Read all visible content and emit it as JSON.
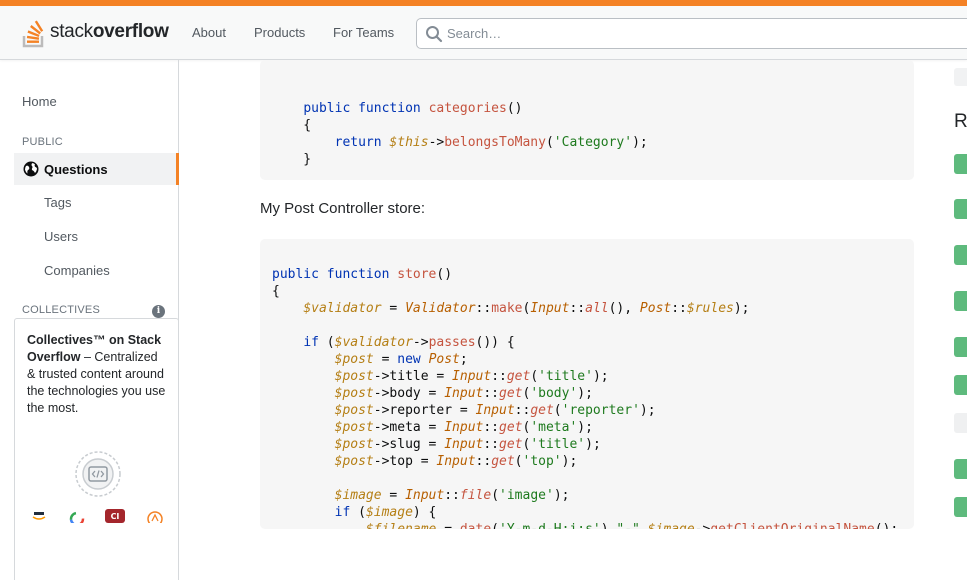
{
  "header": {
    "logo_text_regular": "stack",
    "logo_text_bold": "overflow",
    "nav": [
      "About",
      "Products",
      "For Teams"
    ],
    "search_placeholder": "Search…"
  },
  "sidebar": {
    "home": "Home",
    "public_section": "PUBLIC",
    "active_item": "Questions",
    "items": [
      "Tags",
      "Users",
      "Companies"
    ],
    "collectives_section": "COLLECTIVES",
    "collectives_title": "Collectives™ on Stack Overflow",
    "collectives_desc": " – Centralized & trusted content around the technologies you use the most."
  },
  "post": {
    "paragraph": "My Post Controller store:"
  },
  "right": {
    "heading_fragment": "R"
  },
  "colors": {
    "accent": "#f48225",
    "green_badge": "#5eba7d"
  }
}
